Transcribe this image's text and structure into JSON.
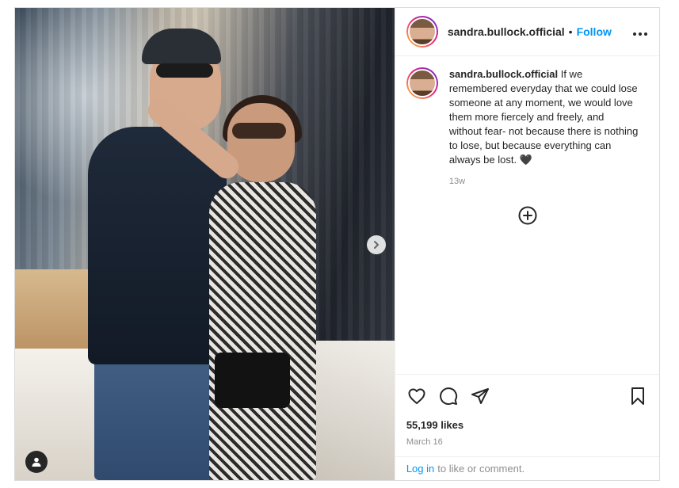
{
  "post": {
    "username": "sandra.bullock.official",
    "follow_label": "Follow",
    "separator": "•",
    "more_label": "•••",
    "caption": "If we remembered everyday that we could lose someone at any moment, we would love them more fiercely and freely, and without fear- not because there is nothing to lose, but because everything can always be lost. 🖤",
    "time_ago": "13w",
    "likes": "55,199 likes",
    "date": "March 16",
    "login_link": "Log in",
    "login_suffix": "to like or comment."
  },
  "icons": {
    "next": "chevron-right-icon",
    "tag": "user-tag-icon",
    "load_more": "plus-circle-icon",
    "like": "heart-icon",
    "comment": "comment-icon",
    "share": "send-icon",
    "save": "bookmark-icon"
  },
  "colors": {
    "accent": "#0095f6",
    "text": "#262626",
    "muted": "#8e8e8e",
    "border": "#dbdbdb"
  }
}
